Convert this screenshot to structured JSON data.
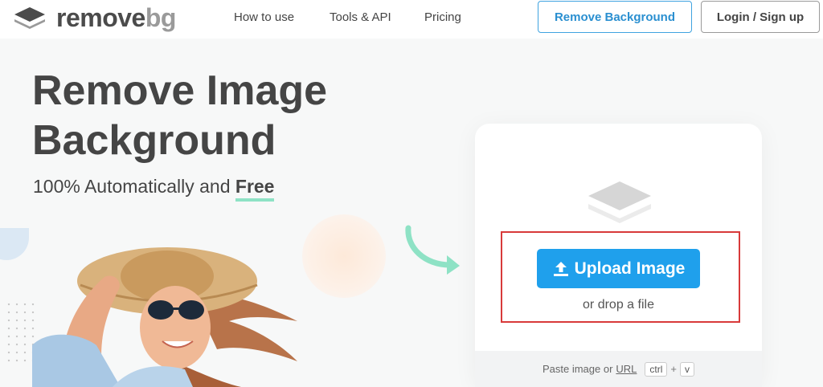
{
  "header": {
    "logo_main": "remove",
    "logo_accent": "bg",
    "nav": [
      "How to use",
      "Tools & API",
      "Pricing"
    ],
    "remove_bg_label": "Remove Background",
    "login_label": "Login / Sign up"
  },
  "hero": {
    "title_line1": "Remove Image",
    "title_line2": "Background",
    "subtitle_prefix": "100% Automatically and ",
    "subtitle_free": "Free"
  },
  "upload": {
    "button_label": "Upload Image",
    "drop_text": "or drop a file",
    "paste_text": "Paste image or",
    "url_text": "URL",
    "key_ctrl": "ctrl",
    "key_plus": "+",
    "key_v": "v"
  },
  "colors": {
    "accent_blue": "#1fa0ec",
    "free_underline": "#8ee2c5",
    "highlight_red": "#d83a3a"
  },
  "icons": [
    "logo-layers-icon",
    "upload-arrow-icon",
    "curved-arrow-icon",
    "layers-placeholder-icon"
  ]
}
